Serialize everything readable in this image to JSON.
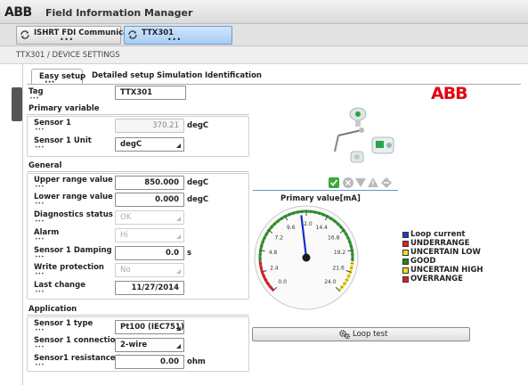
{
  "app": {
    "logo_text": "ABB",
    "title": "Field Information Manager"
  },
  "doc_tabs": [
    {
      "label": "ISHRT FDI Communicati...",
      "dots": "•••"
    },
    {
      "label": "TTX301",
      "dots": "•••"
    }
  ],
  "breadcrumb": "TTX301  /  DEVICE SETTINGS",
  "tabs": [
    {
      "label": "Easy setup",
      "active": true,
      "dots": "•••"
    },
    {
      "label": "Detailed setup",
      "active": false
    },
    {
      "label": "Simulation",
      "active": false
    },
    {
      "label": "Identification",
      "active": false
    }
  ],
  "dots": "•••",
  "tag": {
    "label": "Tag",
    "value": "TTX301"
  },
  "primary_variable": {
    "title": "Primary variable",
    "sensor1": {
      "label": "Sensor 1",
      "value": "370.21",
      "unit": "degC"
    },
    "sensor1_unit": {
      "label": "Sensor 1 Unit",
      "value": "degC"
    }
  },
  "general": {
    "title": "General",
    "upper_range": {
      "label": "Upper range value",
      "value": "850.000",
      "unit": "degC"
    },
    "lower_range": {
      "label": "Lower range value",
      "value": "0.000",
      "unit": "degC"
    },
    "diagnostics": {
      "label": "Diagnostics status",
      "value": "OK"
    },
    "alarm": {
      "label": "Alarm",
      "value": "Hi"
    },
    "damping": {
      "label": "Sensor 1 Damping",
      "value": "0.0",
      "unit": "s"
    },
    "write_protection": {
      "label": "Write protection",
      "value": "No"
    },
    "last_change": {
      "label": "Last change",
      "value": "11/27/2014"
    }
  },
  "application": {
    "title": "Application",
    "sensor_type": {
      "label": "Sensor 1  type",
      "value": "Pt100 (IEC751)"
    },
    "sensor_connection": {
      "label": "Sensor 1 connection",
      "value": "2-wire"
    },
    "sensor_resistance": {
      "label": "Sensor1 resistance t...",
      "value": "0.00",
      "unit": "ohm"
    }
  },
  "right_logo": "ABB",
  "gauge": {
    "title": "Primary value[mA]",
    "min": 0,
    "max": 24,
    "value": 11.4,
    "ticks": [
      "0.0",
      "2.4",
      "4.8",
      "7.2",
      "9.6",
      "12.0",
      "14.4",
      "16.8",
      "19.2",
      "21.6",
      "24.0"
    ],
    "colors": {
      "under": "#e02020",
      "normal": "#2e9a2e",
      "over": "#f0e020",
      "needle": "#1030d0"
    }
  },
  "legend": [
    {
      "label": "Loop current",
      "color": "#1a3fd0"
    },
    {
      "label": "UNDERRANGE",
      "color": "#e02020"
    },
    {
      "label": "UNCERTAIN LOW",
      "color": "#f0e020"
    },
    {
      "label": "GOOD",
      "color": "#1e8a1e"
    },
    {
      "label": "UNCERTAIN HIGH",
      "color": "#f0e020"
    },
    {
      "label": "OVERRANGE",
      "color": "#e02020"
    }
  ],
  "loop_test_label": "Loop test"
}
